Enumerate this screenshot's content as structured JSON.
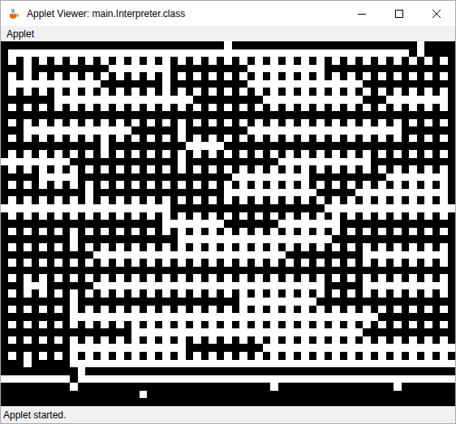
{
  "window": {
    "title": "Applet Viewer: main.Interpreter.class"
  },
  "menu": [
    "Applet"
  ],
  "maze": {
    "cols": 59,
    "rows": [
      {
        "kind": "runs",
        "runs": [
          29,
          1,
          24,
          1,
          4
        ]
      },
      {
        "kind": "runs",
        "runs": [
          1,
          52,
          1,
          1,
          4
        ]
      },
      {
        "kind": "dots"
      },
      {
        "kind": "runs",
        "runs": [
          3,
          1,
          10,
          8,
          10,
          10,
          17
        ]
      },
      {
        "kind": "dots"
      },
      {
        "kind": "runs",
        "runs": [
          1,
          12,
          8,
          1,
          10,
          15,
          12
        ]
      },
      {
        "kind": "dots"
      },
      {
        "kind": "runs",
        "runs": [
          7,
          18,
          9,
          13,
          3,
          8,
          1
        ]
      },
      {
        "kind": "dots"
      },
      {
        "kind": "runs",
        "runs": [
          59
        ]
      },
      {
        "kind": "dots"
      },
      {
        "kind": "runs",
        "runs": [
          3,
          14,
          6,
          1,
          8,
          20,
          7
        ]
      },
      {
        "kind": "dots"
      },
      {
        "kind": "runs",
        "runs": [
          13,
          1,
          10,
          5,
          30
        ]
      },
      {
        "kind": "dots"
      },
      {
        "kind": "runs",
        "runs": [
          0,
          9,
          14,
          1,
          12,
          12,
          11
        ]
      },
      {
        "kind": "dots"
      },
      {
        "kind": "runs",
        "runs": [
          5,
          5,
          20,
          10,
          10,
          8,
          1
        ]
      },
      {
        "kind": "dots"
      },
      {
        "kind": "runs",
        "runs": [
          11,
          1,
          17,
          12,
          5,
          12,
          1
        ]
      },
      {
        "kind": "dots"
      },
      {
        "kind": "runs",
        "runs": [
          0,
          22,
          20,
          17
        ]
      },
      {
        "kind": "dots"
      },
      {
        "kind": "runs",
        "runs": [
          21,
          8,
          7,
          8,
          15
        ]
      },
      {
        "kind": "dots"
      },
      {
        "kind": "runs",
        "runs": [
          9,
          1,
          13,
          20,
          16
        ]
      },
      {
        "kind": "dots"
      },
      {
        "kind": "runs",
        "runs": [
          12,
          25,
          10,
          11,
          1
        ]
      },
      {
        "kind": "dots"
      },
      {
        "kind": "runs",
        "runs": [
          59
        ]
      },
      {
        "kind": "dots"
      },
      {
        "kind": "runs",
        "runs": [
          3,
          3,
          6,
          30,
          5,
          11,
          1
        ]
      },
      {
        "kind": "dots"
      },
      {
        "kind": "runs",
        "runs": [
          9,
          1,
          21,
          10,
          18
        ]
      },
      {
        "kind": "dots"
      },
      {
        "kind": "runs",
        "runs": [
          9,
          40,
          10
        ]
      },
      {
        "kind": "dots"
      },
      {
        "kind": "runs",
        "runs": [
          17,
          30,
          12
        ]
      },
      {
        "kind": "dots"
      },
      {
        "kind": "runs",
        "runs": [
          9,
          15,
          10,
          25
        ]
      },
      {
        "kind": "dots"
      },
      {
        "kind": "runs",
        "runs": [
          3,
          1,
          5,
          50
        ]
      },
      {
        "kind": "runs",
        "runs": [
          10,
          1,
          48
        ]
      },
      {
        "kind": "runs",
        "runs": [
          0,
          9,
          1,
          49
        ]
      },
      {
        "kind": "runs",
        "runs": [
          9,
          1,
          25,
          1,
          15,
          1,
          7
        ]
      },
      {
        "kind": "runs",
        "runs": [
          18,
          1,
          40
        ]
      },
      {
        "kind": "runs",
        "runs": [
          59
        ]
      }
    ]
  },
  "status_bar": "Applet started."
}
